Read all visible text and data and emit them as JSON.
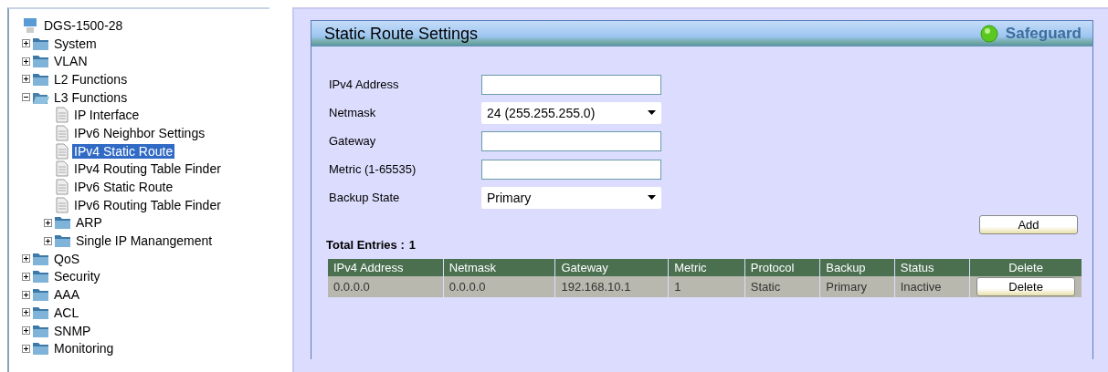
{
  "tree": {
    "root": "DGS-1500-28",
    "items": [
      {
        "label": "System",
        "kind": "folder",
        "expanded": false,
        "selected": false
      },
      {
        "label": "VLAN",
        "kind": "folder",
        "expanded": false,
        "selected": false
      },
      {
        "label": "L2 Functions",
        "kind": "folder",
        "expanded": false,
        "selected": false
      },
      {
        "label": "L3 Functions",
        "kind": "folder",
        "expanded": true,
        "selected": false,
        "children": [
          {
            "label": "IP Interface",
            "kind": "page",
            "selected": false
          },
          {
            "label": "IPv6 Neighbor Settings",
            "kind": "page",
            "selected": false
          },
          {
            "label": "IPv4 Static Route",
            "kind": "page",
            "selected": true
          },
          {
            "label": "IPv4 Routing Table Finder",
            "kind": "page",
            "selected": false
          },
          {
            "label": "IPv6 Static Route",
            "kind": "page",
            "selected": false
          },
          {
            "label": "IPv6 Routing Table Finder",
            "kind": "page",
            "selected": false
          },
          {
            "label": "ARP",
            "kind": "folder",
            "expanded": false,
            "selected": false
          },
          {
            "label": "Single IP Manangement",
            "kind": "folder",
            "expanded": false,
            "selected": false
          }
        ]
      },
      {
        "label": "QoS",
        "kind": "folder",
        "expanded": false,
        "selected": false
      },
      {
        "label": "Security",
        "kind": "folder",
        "expanded": false,
        "selected": false
      },
      {
        "label": "AAA",
        "kind": "folder",
        "expanded": false,
        "selected": false
      },
      {
        "label": "ACL",
        "kind": "folder",
        "expanded": false,
        "selected": false
      },
      {
        "label": "SNMP",
        "kind": "folder",
        "expanded": false,
        "selected": false
      },
      {
        "label": "Monitoring",
        "kind": "folder",
        "expanded": false,
        "selected": false
      }
    ]
  },
  "panel": {
    "title": "Static Route Settings",
    "safeguard": "Safeguard",
    "fields": [
      {
        "label": "IPv4 Address",
        "kind": "input"
      },
      {
        "label": "Netmask",
        "kind": "select",
        "value": "24 (255.255.255.0)"
      },
      {
        "label": "Gateway",
        "kind": "input"
      },
      {
        "label": "Metric (1-65535)",
        "kind": "input"
      },
      {
        "label": "Backup State",
        "kind": "select",
        "value": "Primary"
      }
    ],
    "add_button": "Add",
    "total_entries": {
      "label": "Total Entries :",
      "value": "1"
    },
    "table": {
      "columns": [
        "IPv4 Address",
        "Netmask",
        "Gateway",
        "Metric",
        "Protocol",
        "Backup",
        "Status",
        "Delete"
      ],
      "rows": [
        {
          "cells": [
            "0.0.0.0",
            "0.0.0.0",
            "192.168.10.1",
            "1",
            "Static",
            "Primary",
            "Inactive"
          ],
          "button": "Delete"
        }
      ]
    }
  }
}
